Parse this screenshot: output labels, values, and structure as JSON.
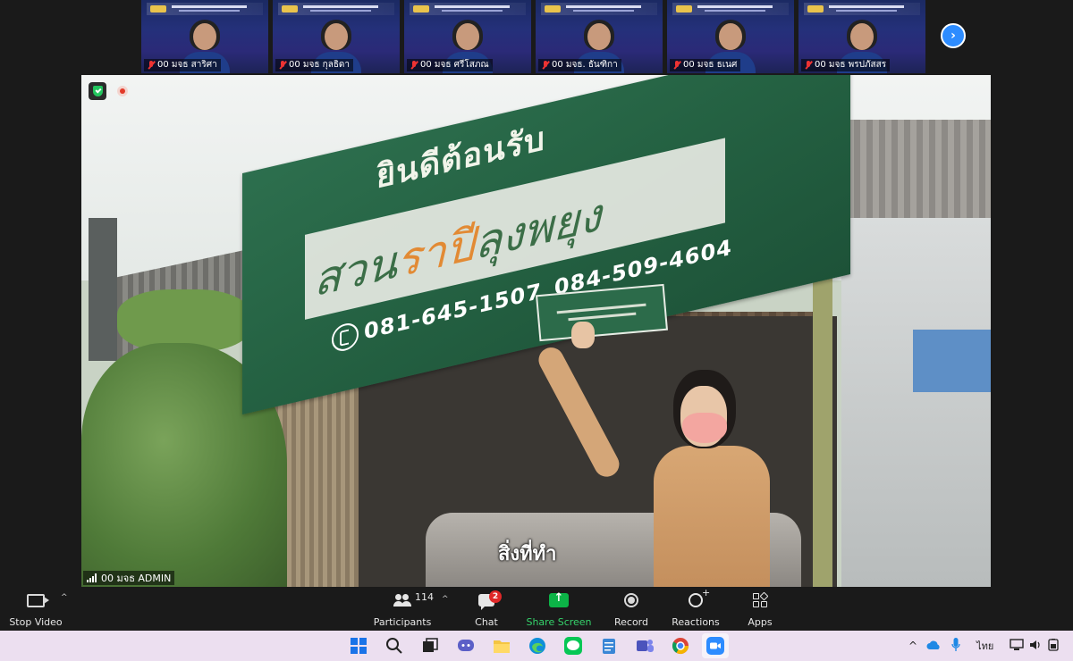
{
  "thumbnails": [
    {
      "name": "00 มจธ สาริศา"
    },
    {
      "name": "00 มจธ กุลธิดา"
    },
    {
      "name": "00 มจธ ศรีโสภณ"
    },
    {
      "name": "00 มจธ. ธันฑิกา"
    },
    {
      "name": "00 มจธ ธเนศ"
    },
    {
      "name": "00 มจธ พรปภัสสร"
    }
  ],
  "main_video": {
    "speaker_name": "00 มจธ ADMIN",
    "sign_welcome": "ยินดีต้อนรับ",
    "sign_name_parts": [
      "สวน",
      "ราปี",
      "ลุงพยุง"
    ],
    "sign_phone_1": "081-645-1507",
    "sign_phone_2": "084-509-4604",
    "subtitle": "สิ่งที่ทำ"
  },
  "toolbar": {
    "stop_video": "Stop Video",
    "participants": "Participants",
    "participants_count": "114",
    "chat": "Chat",
    "chat_badge": "2",
    "share_screen": "Share Screen",
    "record": "Record",
    "reactions": "Reactions",
    "apps": "Apps"
  },
  "taskbar": {
    "language": "ไทย"
  },
  "colors": {
    "zoom_blue": "#2d8cff",
    "share_green": "#0cb447",
    "mute_red": "#e33333"
  }
}
